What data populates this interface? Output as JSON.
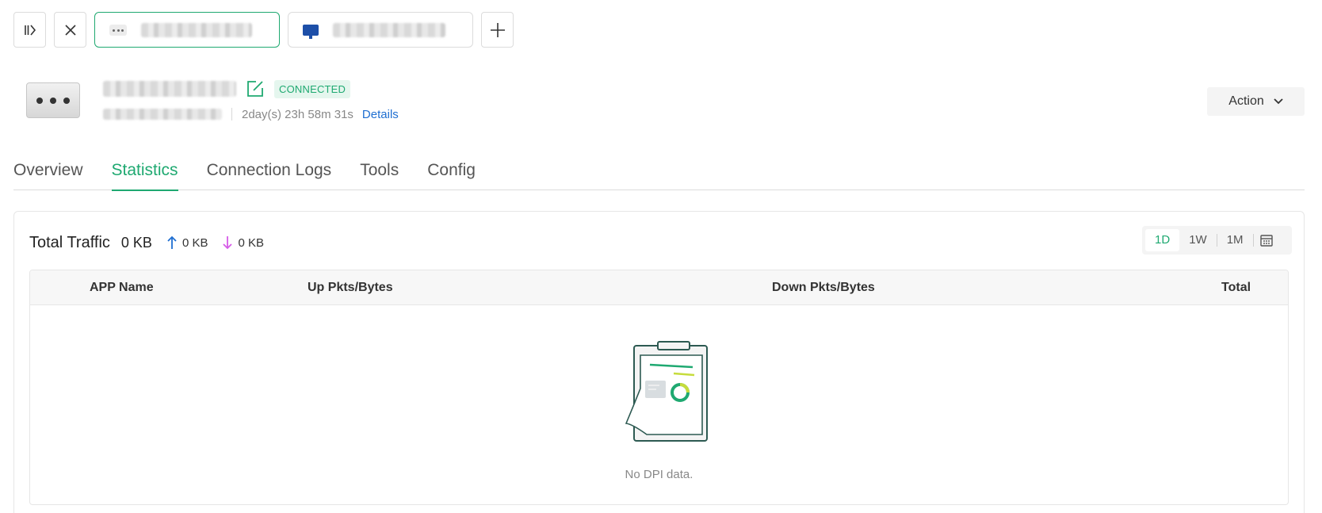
{
  "colors": {
    "accent": "#1fa971",
    "link": "#1f6fd1",
    "upload": "#1f6fd1",
    "download": "#d65be8"
  },
  "topbar": {
    "collapse_icon": "sidebar-collapse-icon",
    "close_icon": "close-icon",
    "add_icon": "plus-icon"
  },
  "device": {
    "status": "CONNECTED",
    "uptime": "2day(s) 23h 58m 31s",
    "details_label": "Details"
  },
  "action": {
    "label": "Action"
  },
  "tabs": [
    {
      "label": "Overview"
    },
    {
      "label": "Statistics"
    },
    {
      "label": "Connection Logs"
    },
    {
      "label": "Tools"
    },
    {
      "label": "Config"
    }
  ],
  "traffic": {
    "title": "Total Traffic",
    "total": "0 KB",
    "up": "0 KB",
    "down": "0 KB"
  },
  "range": {
    "options": [
      "1D",
      "1W",
      "1M"
    ],
    "selected": "1D"
  },
  "table": {
    "columns": [
      "APP Name",
      "Up Pkts/Bytes",
      "Down Pkts/Bytes",
      "Total"
    ],
    "empty_text": "No DPI data."
  }
}
